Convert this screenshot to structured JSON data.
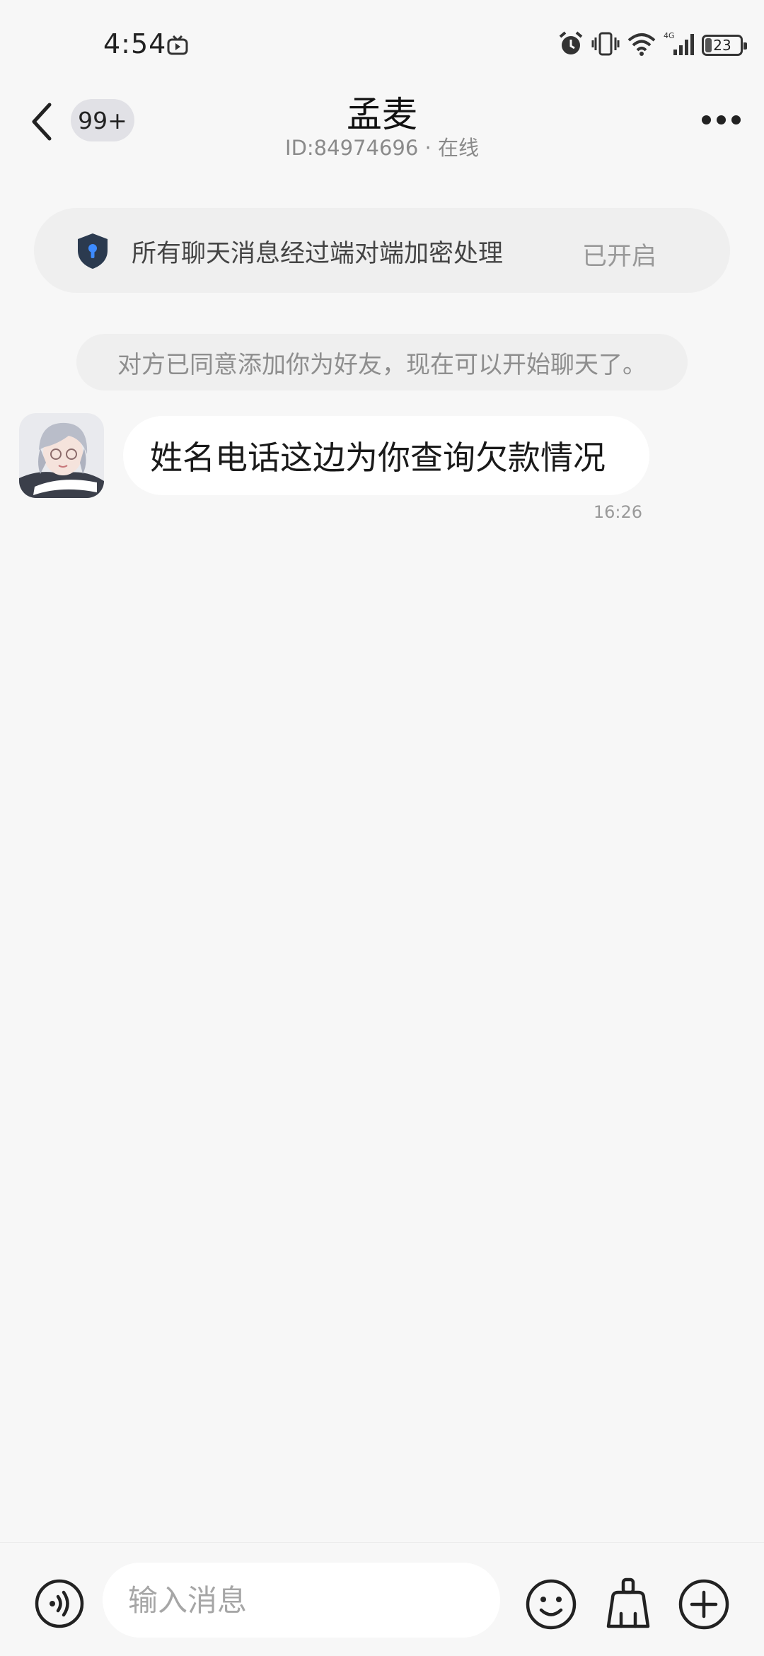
{
  "status_bar": {
    "time": "4:54",
    "network": "4G",
    "battery": "23"
  },
  "header": {
    "unread_badge": "99+",
    "title": "孟麦",
    "subtitle": "ID:84974696 · 在线"
  },
  "encryption_banner": {
    "text": "所有聊天消息经过端对端加密处理",
    "status": "已开启"
  },
  "system_notice": "对方已同意添加你为好友，现在可以开始聊天了。",
  "messages": [
    {
      "text": "姓名电话这边为你查询欠款情况",
      "time": "16:26"
    }
  ],
  "input": {
    "placeholder": "输入消息"
  },
  "colors": {
    "background": "#f7f7f7",
    "bubble": "#ffffff",
    "shield": "#2b3a4f",
    "shield_keyhole": "#3d8bff"
  }
}
